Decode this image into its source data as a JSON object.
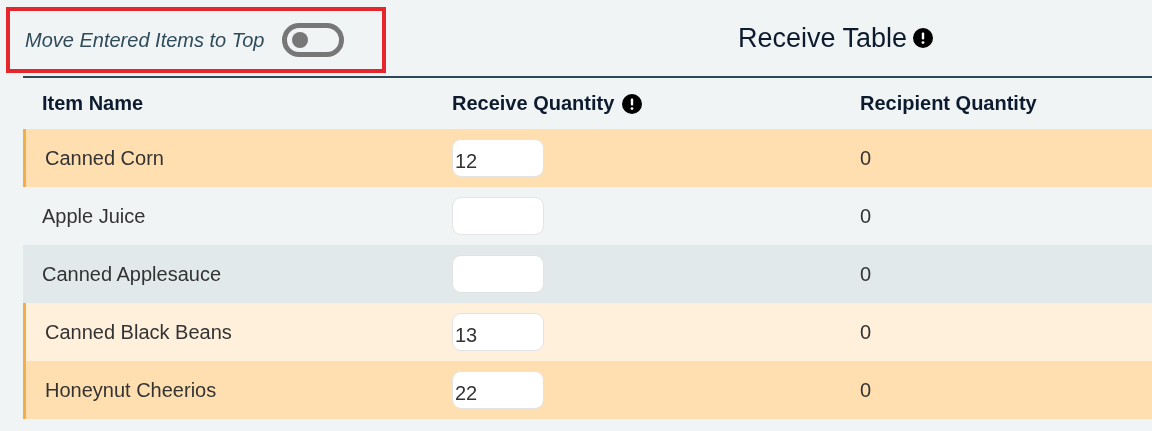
{
  "toggle": {
    "label": "Move Entered Items to Top",
    "on": false,
    "highlighted": true
  },
  "title": {
    "text": "Receive Table",
    "info": true
  },
  "table": {
    "columns": [
      {
        "label": "Item Name"
      },
      {
        "label": "Receive Quantity",
        "info": true
      },
      {
        "label": "Recipient Quantity"
      }
    ],
    "rows": [
      {
        "name": "Canned Corn",
        "quantity": "12",
        "recipient": "0",
        "entered": true
      },
      {
        "name": "Apple Juice",
        "quantity": "",
        "recipient": "0",
        "entered": false
      },
      {
        "name": "Canned Applesauce",
        "quantity": "",
        "recipient": "0",
        "entered": false
      },
      {
        "name": "Canned Black Beans",
        "quantity": "13",
        "recipient": "0",
        "entered": true
      },
      {
        "name": "Honeynut Cheerios",
        "quantity": "22",
        "recipient": "0",
        "entered": true
      }
    ]
  }
}
